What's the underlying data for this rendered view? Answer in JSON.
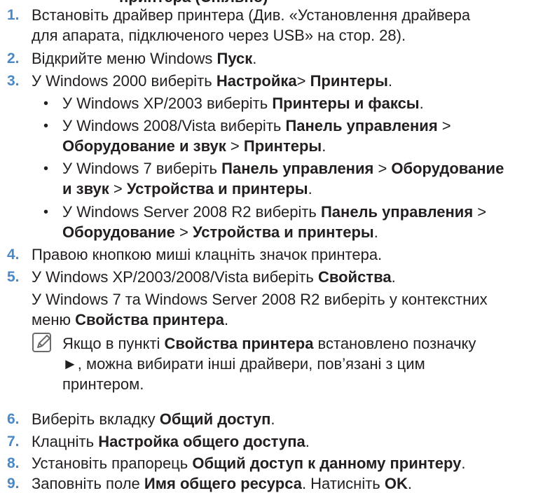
{
  "heading_partial": "принтера (Спільно)",
  "steps": {
    "s1": {
      "num": "1.",
      "l1": "Встановіть драйвер принтера (Див. «Установлення драйвера",
      "l2": "для апарата, підключеного через USB» на стор. 28)."
    },
    "s2": {
      "num": "2.",
      "pre": "Відкрийте меню Windows ",
      "b": "Пуск",
      "post": "."
    },
    "s3": {
      "num": "3.",
      "pre": "У Windows 2000 виберіть ",
      "b1": "Настройка",
      "mid": "> ",
      "b2": "Принтеры",
      "post": "."
    },
    "s4": {
      "num": "4.",
      "text": "Правою кнопкою миші клацніть значок принтера."
    },
    "s5": {
      "num": "5.",
      "pre": "У Windows XP/2003/2008/Vista виберіть ",
      "b": "Свойства",
      "post": ".",
      "p2l1": "У Windows 7 та Windows Server 2008 R2 виберіть у контекстних",
      "p2l2pre": "меню ",
      "p2l2b": "Свойства принтера",
      "p2l2post": "."
    },
    "s6": {
      "num": "6.",
      "pre": "Виберіть вкладку ",
      "b": "Общий доступ",
      "post": "."
    },
    "s7": {
      "num": "7.",
      "pre": "Клацніть ",
      "b": "Настройка общего доступа",
      "post": "."
    },
    "s8": {
      "num": "8.",
      "pre": "Установіть прапорець ",
      "b": "Общий доступ к данному принтеру",
      "post": "."
    },
    "s9": {
      "num": "9.",
      "pre": "Заповніть поле ",
      "b": "Имя общего ресурса",
      "mid": ". Натисніть ",
      "b2": "OK",
      "post": "."
    }
  },
  "sub": {
    "b1": {
      "pre": "У Windows XP/2003 виберіть ",
      "b": "Принтеры и факсы",
      "post": "."
    },
    "b2": {
      "pre": "У Windows 2008/Vista виберіть ",
      "b1": "Панель управления",
      "mid1": " >",
      "b2": "Оборудование и звук",
      "mid2": " > ",
      "b3": "Принтеры",
      "post": "."
    },
    "b3": {
      "pre": "У Windows 7 виберіть ",
      "b1": "Панель управления",
      "mid1": " > ",
      "b2": "Оборудование",
      "b2b": "и звук",
      "mid2": " > ",
      "b3": "Устройства и принтеры",
      "post": "."
    },
    "b4": {
      "pre": "У Windows Server 2008 R2 виберіть ",
      "b1": "Панель управления",
      "mid1": " >",
      "b2": "Оборудование",
      "mid2": " > ",
      "b3": "Устройства и принтеры",
      "post": "."
    }
  },
  "note": {
    "pre": "Якщо в пункті ",
    "b": "Свойства принтера",
    "post": " встановлено позначку",
    "l2": "►, можна вибирати інші драйвери, пов’язані з цим",
    "l3": "принтером.",
    "icon": "note-pencil-icon"
  },
  "colors": {
    "num": "#4a88c6",
    "text": "#231f20"
  }
}
